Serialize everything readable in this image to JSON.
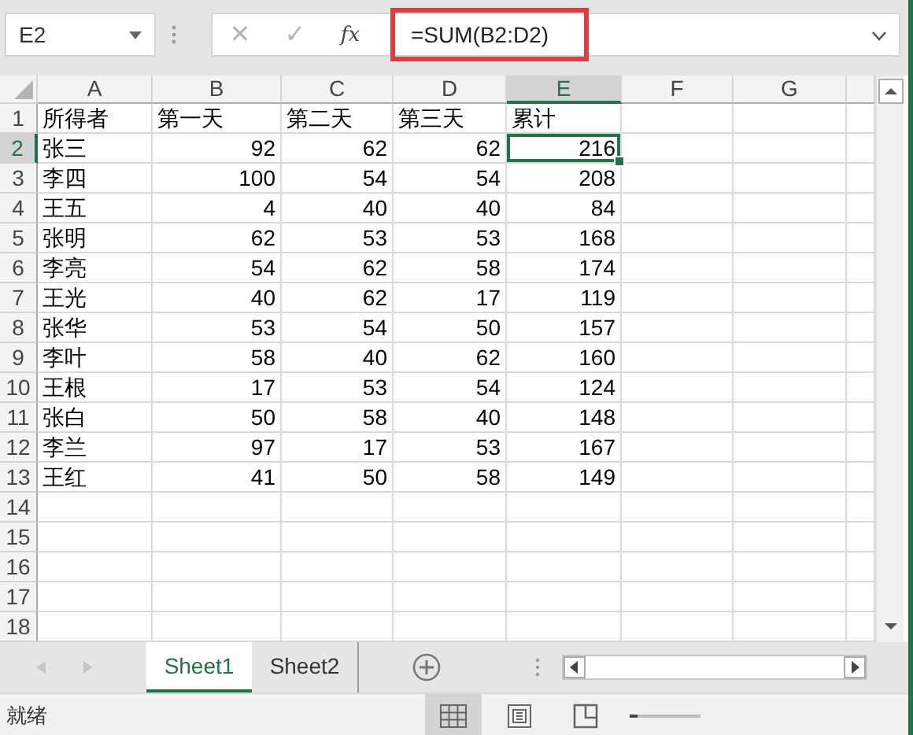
{
  "name_box": {
    "value": "E2"
  },
  "formula_bar": {
    "cancel": "✕",
    "enter": "✓",
    "fx": "fx",
    "formula": "=SUM(B2:D2)",
    "highlighted": true
  },
  "columns": [
    {
      "label": "A",
      "selected": false
    },
    {
      "label": "B",
      "selected": false
    },
    {
      "label": "C",
      "selected": false
    },
    {
      "label": "D",
      "selected": false
    },
    {
      "label": "E",
      "selected": true
    },
    {
      "label": "F",
      "selected": false
    },
    {
      "label": "G",
      "selected": false
    }
  ],
  "rows": [
    {
      "number": "1",
      "selected": false,
      "cells": [
        "所得者",
        "第一天",
        "第二天",
        "第三天",
        "累计"
      ]
    },
    {
      "number": "2",
      "selected": true,
      "cells": [
        "张三",
        "92",
        "62",
        "62",
        "216"
      ]
    },
    {
      "number": "3",
      "selected": false,
      "cells": [
        "李四",
        "100",
        "54",
        "54",
        "208"
      ]
    },
    {
      "number": "4",
      "selected": false,
      "cells": [
        "王五",
        "4",
        "40",
        "40",
        "84"
      ]
    },
    {
      "number": "5",
      "selected": false,
      "cells": [
        "张明",
        "62",
        "53",
        "53",
        "168"
      ]
    },
    {
      "number": "6",
      "selected": false,
      "cells": [
        "李亮",
        "54",
        "62",
        "58",
        "174"
      ]
    },
    {
      "number": "7",
      "selected": false,
      "cells": [
        "王光",
        "40",
        "62",
        "17",
        "119"
      ]
    },
    {
      "number": "8",
      "selected": false,
      "cells": [
        "张华",
        "53",
        "54",
        "50",
        "157"
      ]
    },
    {
      "number": "9",
      "selected": false,
      "cells": [
        "李叶",
        "58",
        "40",
        "62",
        "160"
      ]
    },
    {
      "number": "10",
      "selected": false,
      "cells": [
        "王根",
        "17",
        "53",
        "54",
        "124"
      ]
    },
    {
      "number": "11",
      "selected": false,
      "cells": [
        "张白",
        "50",
        "58",
        "40",
        "148"
      ]
    },
    {
      "number": "12",
      "selected": false,
      "cells": [
        "李兰",
        "97",
        "17",
        "53",
        "167"
      ]
    },
    {
      "number": "13",
      "selected": false,
      "cells": [
        "王红",
        "41",
        "50",
        "58",
        "149"
      ]
    },
    {
      "number": "14",
      "selected": false
    },
    {
      "number": "15",
      "selected": false
    },
    {
      "number": "16",
      "selected": false
    },
    {
      "number": "17",
      "selected": false
    },
    {
      "number": "18",
      "selected": false
    }
  ],
  "sheet_tabs": [
    {
      "label": "Sheet1",
      "selected": true
    },
    {
      "label": "Sheet2",
      "selected": false
    }
  ],
  "status_bar": {
    "text": "就绪",
    "views": [
      {
        "selected": true
      },
      {
        "selected": false
      },
      {
        "selected": false
      }
    ],
    "zoom": {
      "level": 0.12
    }
  }
}
